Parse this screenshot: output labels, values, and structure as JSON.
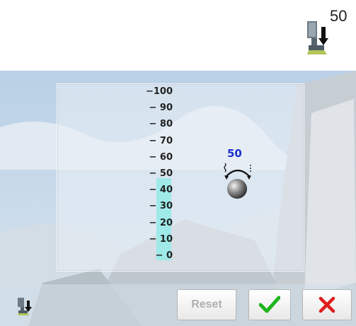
{
  "header": {
    "presser_foot_icon": "presser-foot-down-icon",
    "value": "50"
  },
  "scale": {
    "labels": [
      "100",
      "90",
      "80",
      "70",
      "60",
      "50",
      "40",
      "30",
      "20",
      "10",
      "0"
    ],
    "current_value": "50",
    "level_fraction": 0.5,
    "fill_color": "#9fe9e9",
    "value_color": "#1a2fd0"
  },
  "knob": {
    "icon": "knob-rotate-icon"
  },
  "bottom_bar": {
    "foot_icon": "presser-foot-down-icon",
    "reset_label": "Reset",
    "ok_icon": "check-icon",
    "ok_color": "#1db51d",
    "cancel_icon": "close-icon",
    "cancel_color": "#e01b1b"
  }
}
